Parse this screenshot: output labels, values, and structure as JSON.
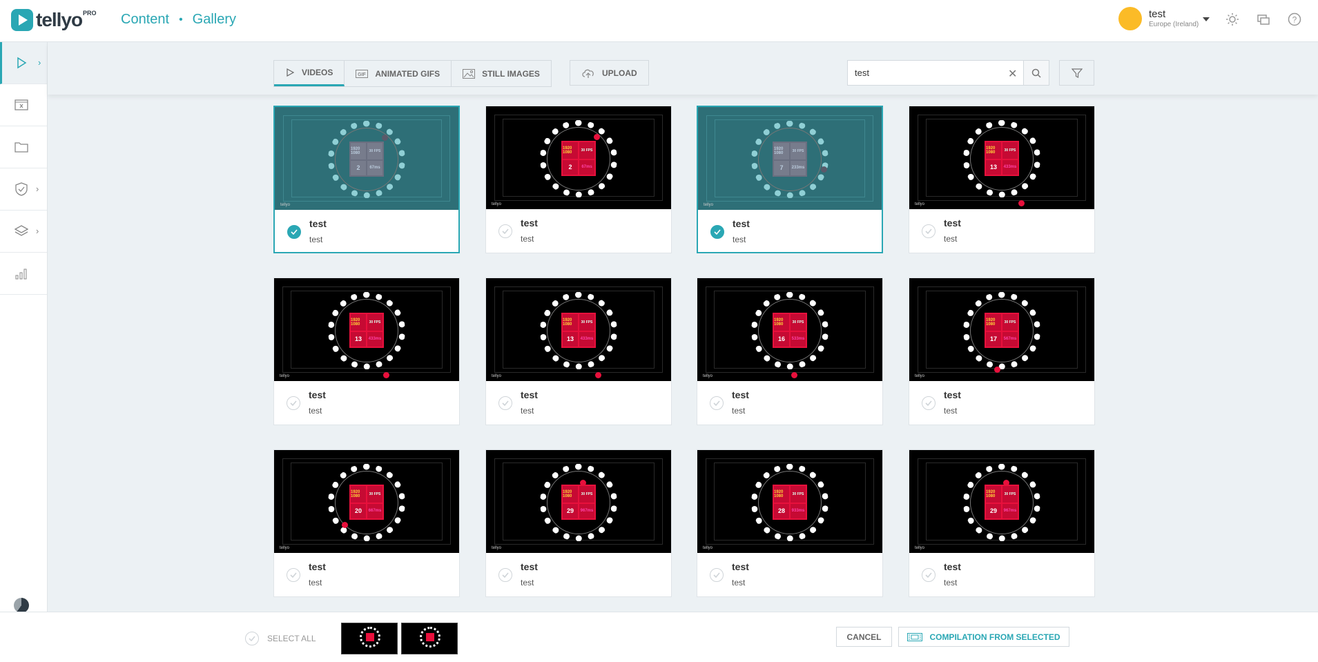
{
  "app": {
    "name": "tellyo",
    "badge": "PRO"
  },
  "breadcrumb": {
    "section": "Content",
    "separator": "•",
    "page": "Gallery"
  },
  "user": {
    "name": "test",
    "region": "Europe (Ireland)",
    "avatar_color": "#fbbb27"
  },
  "colors": {
    "accent": "#2aa7b4",
    "background": "#ecf1f4",
    "thumb_red": "#e8103c"
  },
  "header_icons": [
    "theme-sun-icon",
    "chat-windows-icon",
    "help-icon"
  ],
  "sidebar": {
    "items": [
      {
        "name": "videos",
        "icon": "play-icon",
        "active": true,
        "expandable": true
      },
      {
        "name": "clipper",
        "icon": "clip-editor-icon",
        "active": false,
        "expandable": false
      },
      {
        "name": "folders",
        "icon": "folder-icon",
        "active": false,
        "expandable": false
      },
      {
        "name": "security",
        "icon": "shield-icon",
        "active": false,
        "expandable": true
      },
      {
        "name": "layers",
        "icon": "layers-icon",
        "active": false,
        "expandable": true
      },
      {
        "name": "analytics",
        "icon": "bar-chart-icon",
        "active": false,
        "expandable": false
      }
    ]
  },
  "toolbar": {
    "tabs": [
      {
        "label": "VIDEOS",
        "icon": "play-outline-icon",
        "active": true
      },
      {
        "label": "ANIMATED GIFS",
        "icon": "gif-icon",
        "active": false
      },
      {
        "label": "STILL IMAGES",
        "icon": "image-icon",
        "active": false
      }
    ],
    "upload_label": "UPLOAD",
    "search_value": "test",
    "search_clear": "✕"
  },
  "thumb_text": {
    "res": "1920 1080",
    "fps": "30 FPS",
    "watermark": "tellyo"
  },
  "cards": [
    {
      "title": "test",
      "subtitle": "test",
      "selected": true,
      "num": "2",
      "ms": "67ms"
    },
    {
      "title": "test",
      "subtitle": "test",
      "selected": false,
      "num": "2",
      "ms": "67ms"
    },
    {
      "title": "test",
      "subtitle": "test",
      "selected": true,
      "num": "7",
      "ms": "233ms"
    },
    {
      "title": "test",
      "subtitle": "test",
      "selected": false,
      "num": "13",
      "ms": "433ms"
    },
    {
      "title": "test",
      "subtitle": "test",
      "selected": false,
      "num": "13",
      "ms": "433ms"
    },
    {
      "title": "test",
      "subtitle": "test",
      "selected": false,
      "num": "13",
      "ms": "433ms"
    },
    {
      "title": "test",
      "subtitle": "test",
      "selected": false,
      "num": "16",
      "ms": "533ms"
    },
    {
      "title": "test",
      "subtitle": "test",
      "selected": false,
      "num": "17",
      "ms": "567ms"
    },
    {
      "title": "test",
      "subtitle": "test",
      "selected": false,
      "num": "20",
      "ms": "667ms"
    },
    {
      "title": "test",
      "subtitle": "test",
      "selected": false,
      "num": "29",
      "ms": "967ms"
    },
    {
      "title": "test",
      "subtitle": "test",
      "selected": false,
      "num": "28",
      "ms": "933ms"
    },
    {
      "title": "test",
      "subtitle": "test",
      "selected": false,
      "num": "29",
      "ms": "967ms"
    }
  ],
  "bottombar": {
    "select_all_label": "SELECT ALL",
    "cancel_label": "CANCEL",
    "compilation_label": "COMPILATION FROM SELECTED"
  }
}
